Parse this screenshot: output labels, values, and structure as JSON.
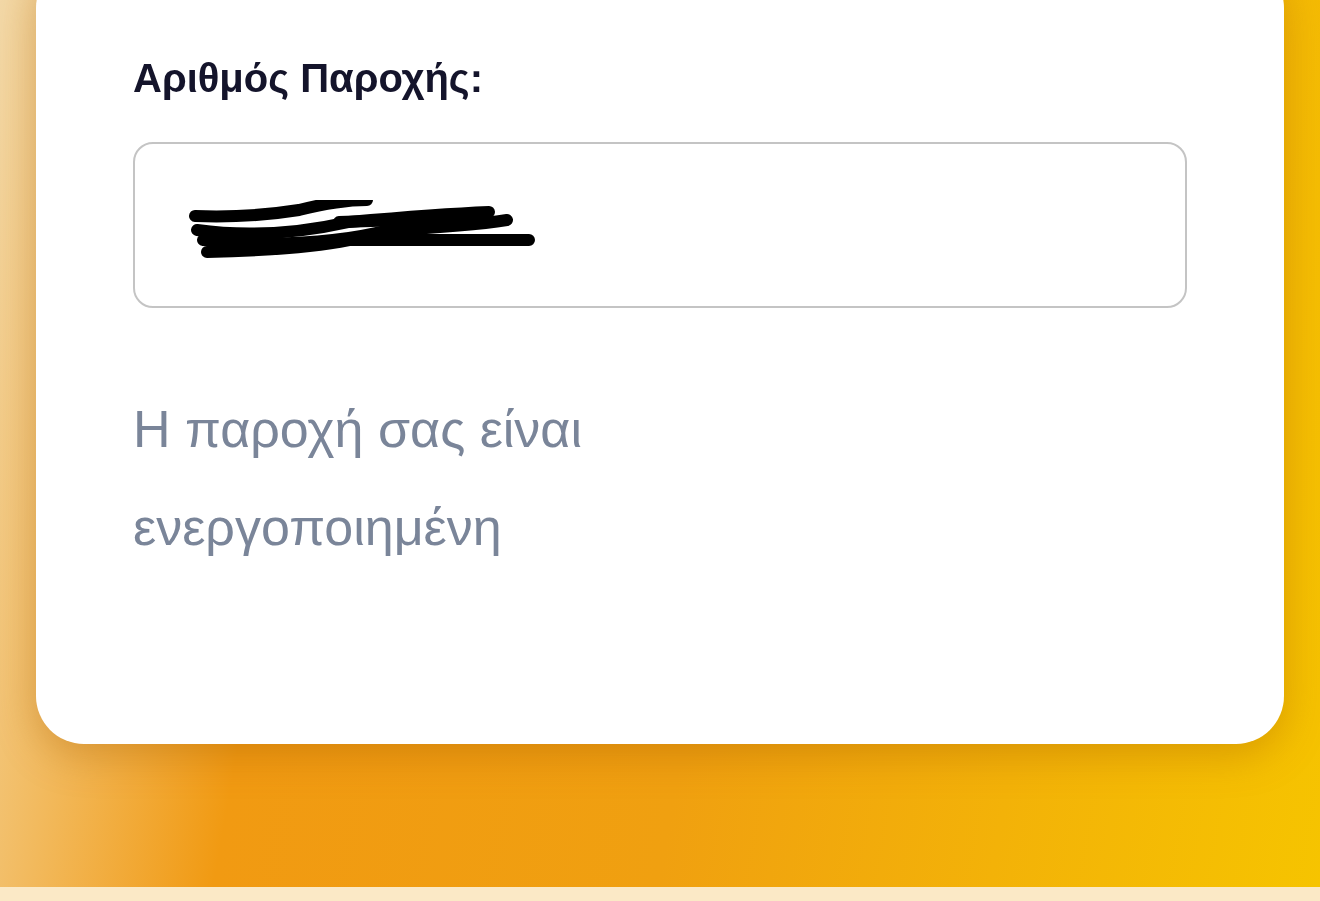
{
  "label": "Αριθμός Παροχής:",
  "field": {
    "redacted": true
  },
  "status_message": "Η παροχή σας είναι ενεργοποιημένη"
}
